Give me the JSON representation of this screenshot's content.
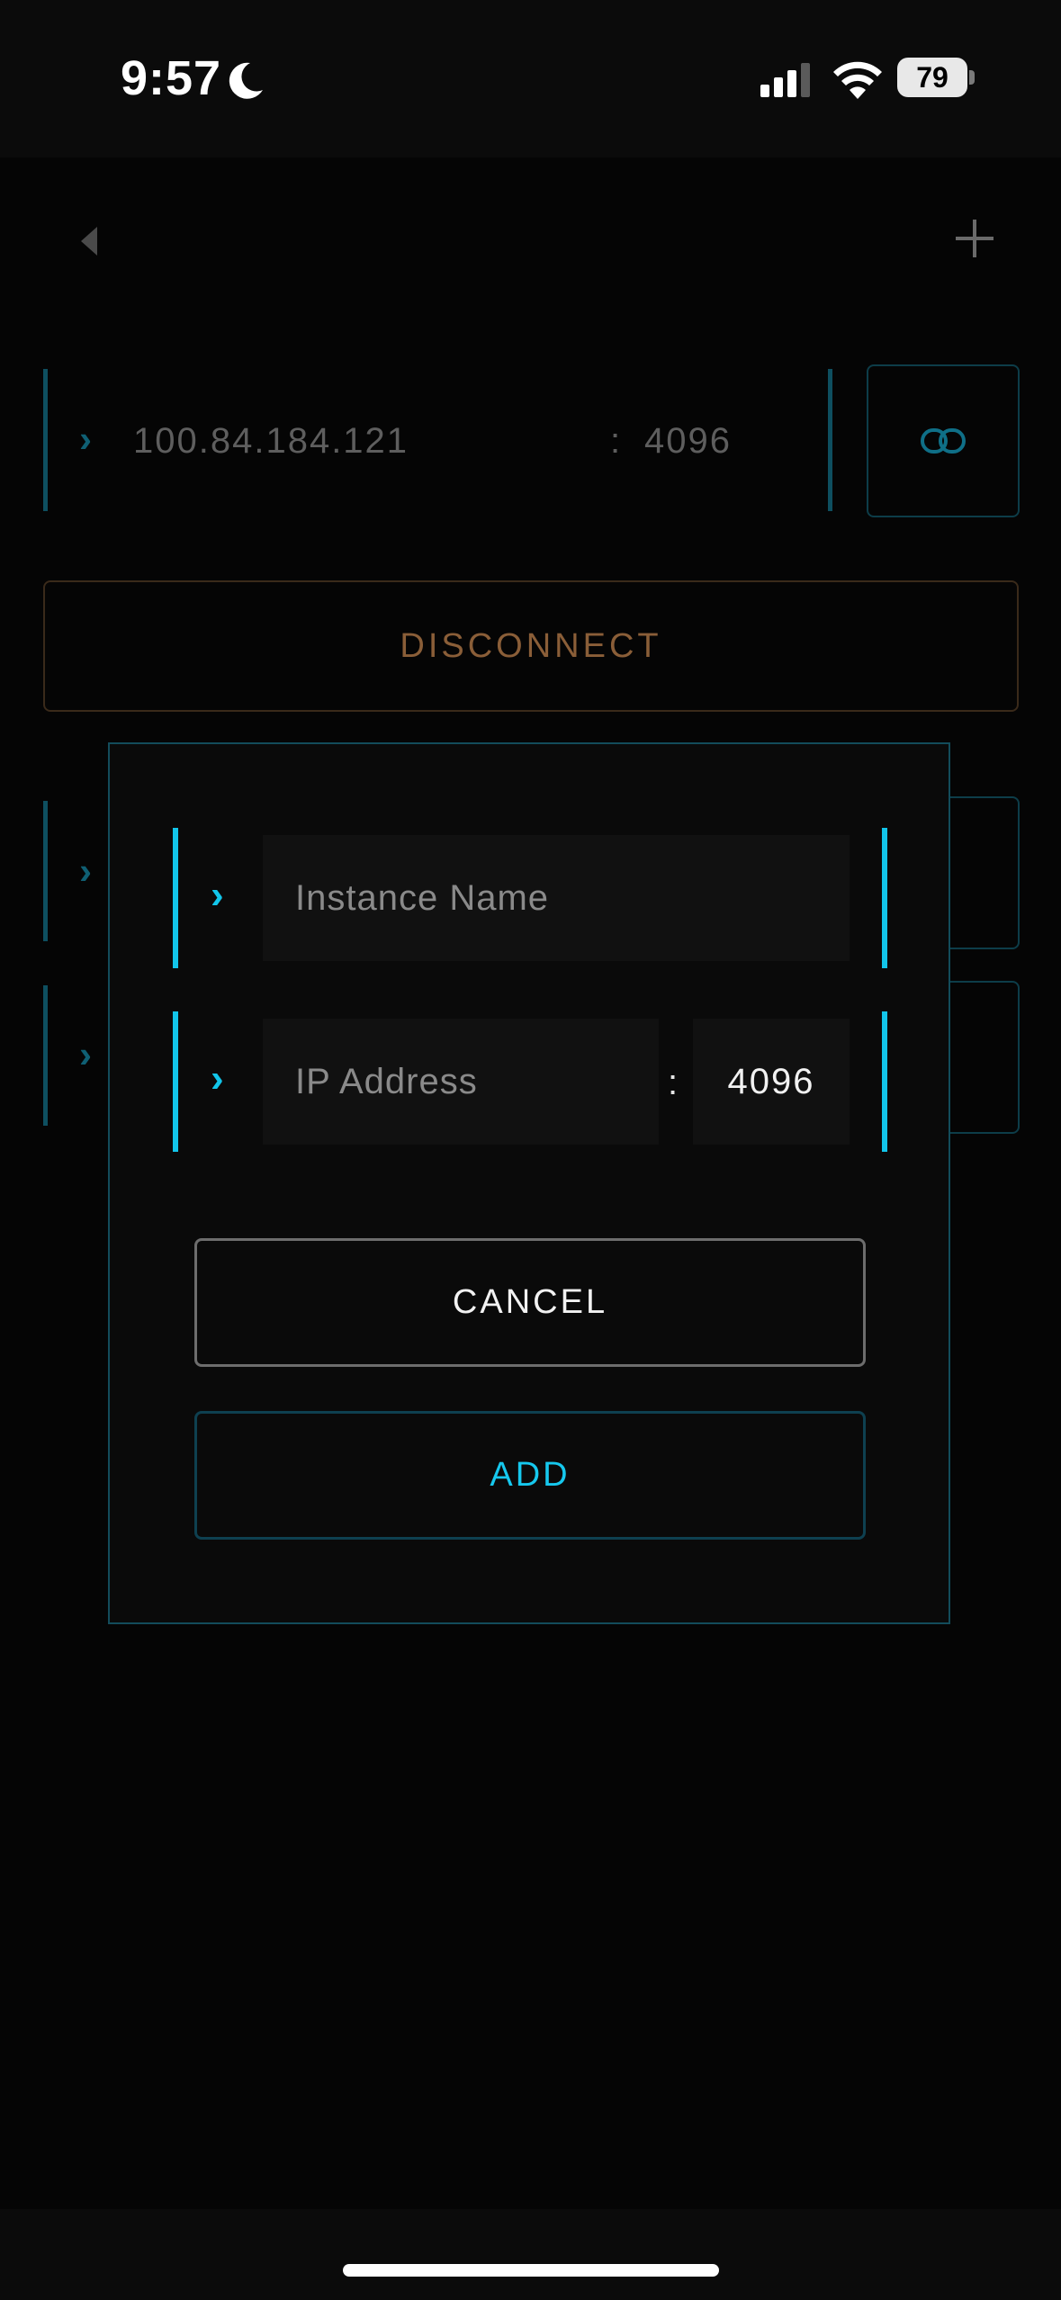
{
  "status_bar": {
    "time": "9:57",
    "battery": "79"
  },
  "nav": {
    "back_icon": "triangle-left-icon",
    "add_icon": "plus-icon"
  },
  "instances": [
    {
      "ip": "100.84.184.121",
      "separator": ":",
      "port": "4096",
      "action_icon": "link-icon"
    }
  ],
  "disconnect_label": "DISCONNECT",
  "dialog": {
    "name_placeholder": "Instance Name",
    "ip_placeholder": "IP Address",
    "separator": ":",
    "port_value": "4096",
    "cancel_label": "CANCEL",
    "add_label": "ADD"
  },
  "colors": {
    "accent": "#12c5ea",
    "accent_dim": "#0e4f60",
    "disconnect": "#8a5e38",
    "background": "#050505"
  }
}
